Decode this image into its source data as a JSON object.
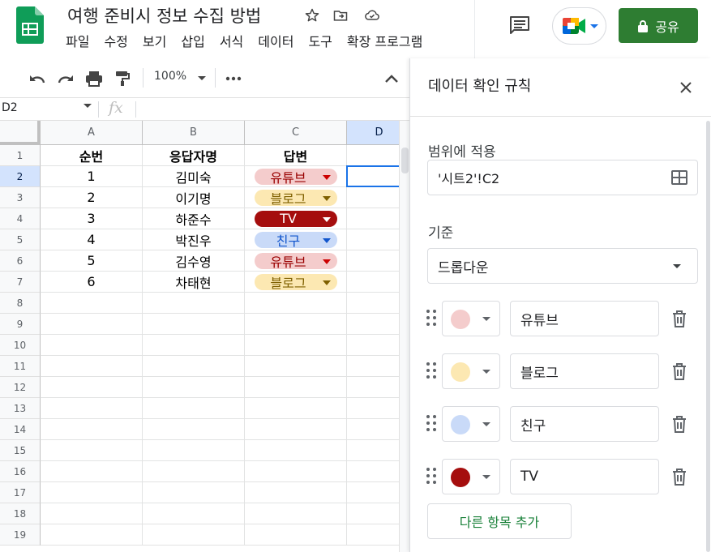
{
  "document": {
    "title": "여행 준비시 정보 수집 방법"
  },
  "menu": [
    "파일",
    "수정",
    "보기",
    "삽입",
    "서식",
    "데이터",
    "도구",
    "확장 프로그램"
  ],
  "share": {
    "label": "공유"
  },
  "toolbar": {
    "zoom": "100%"
  },
  "formula_bar": {
    "name_box": "D2",
    "fx": "fx"
  },
  "grid": {
    "columns": [
      "A",
      "B",
      "C",
      "D"
    ],
    "rows": [
      "1",
      "2",
      "3",
      "4",
      "5",
      "6",
      "7",
      "8",
      "9",
      "10",
      "11",
      "12",
      "13",
      "14",
      "15",
      "16",
      "17",
      "18",
      "19"
    ],
    "headers": {
      "a": "순번",
      "b": "응답자명",
      "c": "답변"
    },
    "data": [
      {
        "a": "1",
        "b": "김미숙",
        "c": "유튜브",
        "chip": "youtube"
      },
      {
        "a": "2",
        "b": "이기명",
        "c": "블로그",
        "chip": "blog"
      },
      {
        "a": "3",
        "b": "하준수",
        "c": "TV",
        "chip": "tv"
      },
      {
        "a": "4",
        "b": "박진우",
        "c": "친구",
        "chip": "friend"
      },
      {
        "a": "5",
        "b": "김수영",
        "c": "유튜브",
        "chip": "youtube"
      },
      {
        "a": "6",
        "b": "차태현",
        "c": "블로그",
        "chip": "blog"
      }
    ]
  },
  "chip_colors": {
    "youtube": {
      "bg": "#f4cccc",
      "fg": "#990000",
      "caret": "#cc0000"
    },
    "blog": {
      "bg": "#fce8b2",
      "fg": "#7f6000",
      "caret": "#7f6000"
    },
    "tv": {
      "bg": "#a50e0e",
      "fg": "#ffffff",
      "caret": "#ffffff"
    },
    "friend": {
      "bg": "#c9daf8",
      "fg": "#1155cc",
      "caret": "#1155cc"
    }
  },
  "panel": {
    "title": "데이터 확인 규칙",
    "range_label": "범위에 적용",
    "range_value": "'시트2'!C2",
    "criteria_label": "기준",
    "criteria_value": "드롭다운",
    "items": [
      {
        "value": "유튜브",
        "color": "#f4cccc"
      },
      {
        "value": "블로그",
        "color": "#fce8b2"
      },
      {
        "value": "친구",
        "color": "#c9daf8"
      },
      {
        "value": "TV",
        "color": "#a50e0e"
      }
    ],
    "add_button": "다른 항목 추가"
  },
  "colors": {
    "share_green": "#2e7d32",
    "selection_blue": "#1a73e8",
    "add_green": "#188038"
  }
}
